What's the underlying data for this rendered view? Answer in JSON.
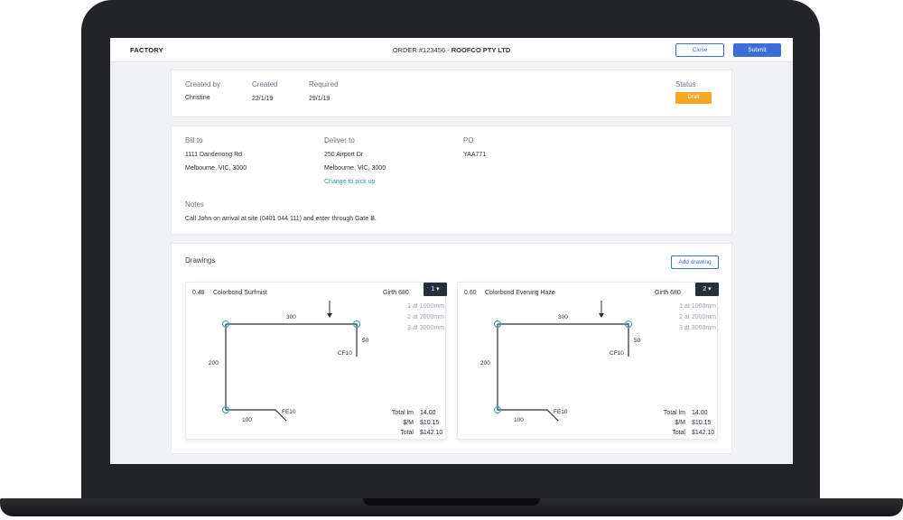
{
  "header": {
    "brand": "FACTORY",
    "order_prefix": "ORDER #123456 - ",
    "order_company": "ROOFCO PTY LTD",
    "close_label": "Close",
    "submit_label": "Submit"
  },
  "summary": {
    "created_by_label": "Created by",
    "created_by": "Christine",
    "created_label": "Created",
    "created": "22/1/19",
    "required_label": "Required",
    "required": "29/1/19",
    "status_label": "Status",
    "status": "Draft"
  },
  "details": {
    "bill_to_label": "Bill to",
    "bill_to_line1": "1111 Dandenong Rd",
    "bill_to_line2": "Melbourne, VIC, 3000",
    "deliver_to_label": "Deliver to",
    "deliver_to_line1": "250 Airport Dr",
    "deliver_to_line2": "Melbourne, VIC, 3000",
    "change_link": "Change to pick up",
    "po_label": "PO",
    "po": "YAA771",
    "notes_label": "Notes",
    "notes": "Call John on arrival at site (0401 044 111) and enter through Gate B."
  },
  "drawings": {
    "title": "Drawings",
    "add_label": "Add drawing",
    "items": [
      {
        "gauge": "0.48",
        "color": "Colorbond Surfmist",
        "girth": "Girth 680",
        "qty": "1 ▾",
        "lengths": [
          "1 at 1000mm",
          "2 at 2000mm",
          "3 at 3000mm"
        ],
        "dims": {
          "top": "300",
          "right": "50",
          "left": "200",
          "bottom": "100",
          "cf": "CF10",
          "fe": "FE10"
        },
        "total_lm_label": "Total lm",
        "total_lm": "14.00",
        "per_m_label": "$/M",
        "per_m": "$10.15",
        "total_label": "Total",
        "total": "$142.10"
      },
      {
        "gauge": "0.60",
        "color": "Colorbond Evening Haze",
        "girth": "Girth 680",
        "qty": "2 ▾",
        "lengths": [
          "1 at 1000mm",
          "2 at 2000mm",
          "3 at 3000mm"
        ],
        "dims": {
          "top": "300",
          "right": "50",
          "left": "200",
          "bottom": "100",
          "cf": "CF10",
          "fe": "FE10"
        },
        "total_lm_label": "Total lm",
        "total_lm": "14.00",
        "per_m_label": "$/M",
        "per_m": "$10.15",
        "total_label": "Total",
        "total": "$142.10"
      }
    ]
  },
  "colors": {
    "accent": "#3b6fd8",
    "status_draft": "#f5a623",
    "link": "#2aa5a0",
    "node": "#2aa5a0"
  }
}
